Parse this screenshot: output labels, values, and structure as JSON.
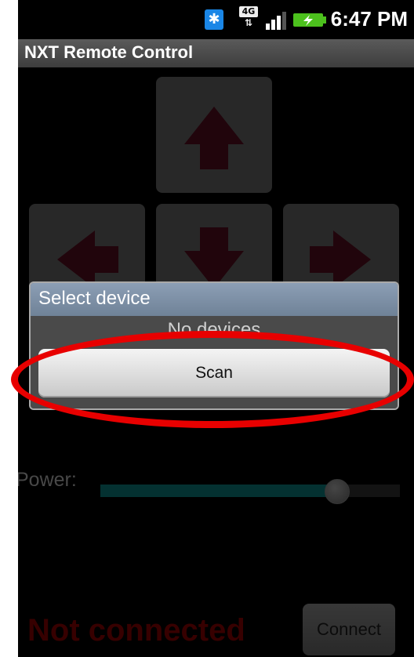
{
  "status_bar": {
    "network_label": "4G",
    "time": "6:47 PM"
  },
  "app": {
    "title": "NXT Remote Control"
  },
  "controls": {
    "power_label": "Power:",
    "power_fraction": 0.79,
    "connection_status": "Not connected",
    "connect_label": "Connect",
    "arrow_color": "#4a0d1b"
  },
  "dialog": {
    "title": "Select device",
    "empty_message": "No devices",
    "scan_label": "Scan"
  },
  "annotation": {
    "ring_color": "#e80000"
  }
}
